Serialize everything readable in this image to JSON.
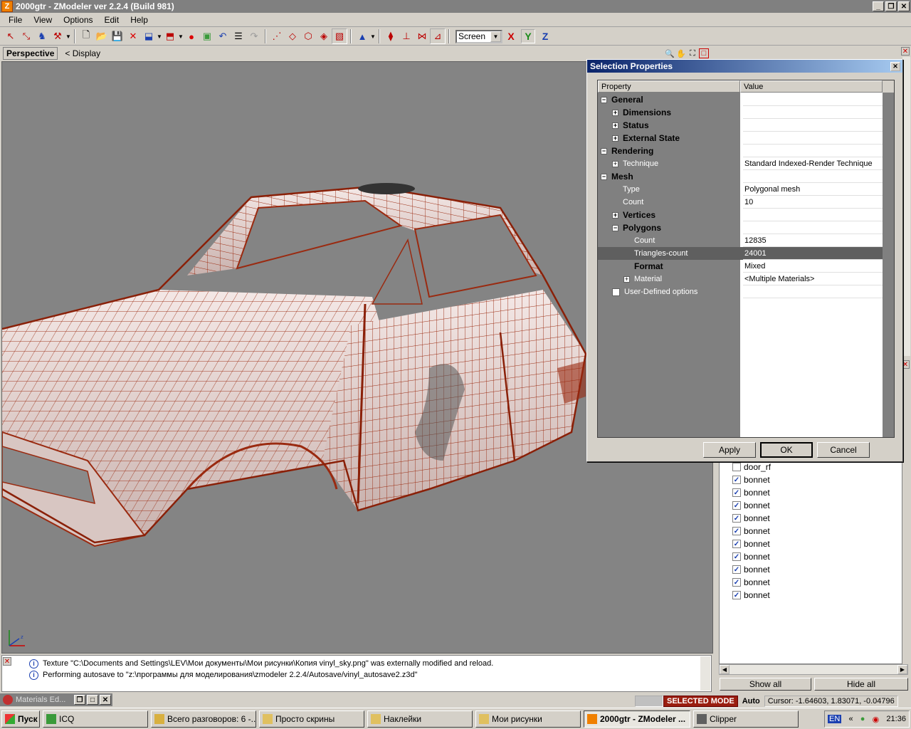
{
  "window": {
    "title": "2000gtr - ZModeler ver 2.2.4 (Build 981)",
    "icon_letter": "Z"
  },
  "menu": [
    "File",
    "View",
    "Options",
    "Edit",
    "Help"
  ],
  "toolbar": {
    "view_select": "Screen",
    "axis_x": "X",
    "axis_y": "Y",
    "axis_z": "Z"
  },
  "viewport": {
    "tab": "Perspective",
    "display": "< Display"
  },
  "dialog": {
    "title": "Selection Properties",
    "col_property": "Property",
    "col_value": "Value",
    "rows": [
      {
        "name": "General",
        "value": "",
        "indent": 0,
        "bold": true,
        "exp": "−"
      },
      {
        "name": "Dimensions",
        "value": "",
        "indent": 1,
        "bold": true,
        "exp": "+"
      },
      {
        "name": "Status",
        "value": "",
        "indent": 1,
        "bold": true,
        "exp": "+"
      },
      {
        "name": "External State",
        "value": "",
        "indent": 1,
        "bold": true,
        "exp": "+"
      },
      {
        "name": "Rendering",
        "value": "",
        "indent": 0,
        "bold": true,
        "exp": "−"
      },
      {
        "name": "Technique",
        "value": "Standard Indexed-Render Technique",
        "indent": 1,
        "bold": false,
        "exp": "+"
      },
      {
        "name": "Mesh",
        "value": "",
        "indent": 0,
        "bold": true,
        "exp": "−"
      },
      {
        "name": "Type",
        "value": "Polygonal mesh",
        "indent": 1,
        "bold": false,
        "exp": ""
      },
      {
        "name": "Count",
        "value": "10",
        "indent": 1,
        "bold": false,
        "exp": ""
      },
      {
        "name": "Vertices",
        "value": "",
        "indent": 1,
        "bold": true,
        "exp": "+"
      },
      {
        "name": "Polygons",
        "value": "",
        "indent": 1,
        "bold": true,
        "exp": "−"
      },
      {
        "name": "Count",
        "value": "12835",
        "indent": 2,
        "bold": false,
        "exp": ""
      },
      {
        "name": "Triangles-count",
        "value": "24001",
        "indent": 2,
        "bold": false,
        "exp": "",
        "highlight": true
      },
      {
        "name": "Format",
        "value": "Mixed",
        "indent": 2,
        "bold": true,
        "exp": ""
      },
      {
        "name": "Material",
        "value": "<Multiple Materials>",
        "indent": 2,
        "bold": false,
        "exp": "+"
      },
      {
        "name": "User-Defined options",
        "value": "",
        "indent": 1,
        "bold": false,
        "exp": "",
        "checkbox": true
      }
    ],
    "apply": "Apply",
    "ok": "OK",
    "cancel": "Cancel"
  },
  "objects": [
    {
      "name": "door_rf",
      "checked": false
    },
    {
      "name": "bonnet",
      "checked": true
    },
    {
      "name": "bonnet",
      "checked": true
    },
    {
      "name": "bonnet",
      "checked": true
    },
    {
      "name": "bonnet",
      "checked": true
    },
    {
      "name": "bonnet",
      "checked": true
    },
    {
      "name": "bonnet",
      "checked": true
    },
    {
      "name": "bonnet",
      "checked": true
    },
    {
      "name": "bonnet",
      "checked": true
    },
    {
      "name": "bonnet",
      "checked": true
    },
    {
      "name": "bonnet",
      "checked": true
    }
  ],
  "object_buttons": {
    "show_all": "Show all",
    "hide_all": "Hide all"
  },
  "log": [
    "Texture \"C:\\Documents and Settings\\LEV\\Мои документы\\Мои рисунки\\Копия vinyl_sky.png\" was externally modified and reload.",
    "Performing autosave to \"z:\\программы для моделирования\\zmodeler 2.2.4/Autosave/vinyl_autosave2.z3d\""
  ],
  "dock": {
    "materials": "Materials Ed..."
  },
  "status": {
    "mode": "SELECTED MODE",
    "auto": "Auto",
    "cursor": "Cursor: -1.64603, 1.83071, -0.04796"
  },
  "taskbar": {
    "start": "Пуск",
    "tasks": [
      {
        "label": "ICQ",
        "width": 148,
        "active": false,
        "color": "#3a9a3a"
      },
      {
        "label": "Всего разговоров: 6 -...",
        "width": 148,
        "active": false,
        "color": "#d8b040"
      },
      {
        "label": "Просто скрины",
        "width": 148,
        "active": false,
        "color": "#e0c060"
      },
      {
        "label": "Наклейки",
        "width": 148,
        "active": false,
        "color": "#e0c060"
      },
      {
        "label": "Мои рисунки",
        "width": 148,
        "active": false,
        "color": "#e0c060"
      },
      {
        "label": "2000gtr - ZModeler ...",
        "width": 150,
        "active": true,
        "color": "#f08000"
      },
      {
        "label": "Clipper",
        "width": 148,
        "active": false,
        "color": "#606060"
      }
    ],
    "lang": "EN",
    "clock": "21:36"
  }
}
